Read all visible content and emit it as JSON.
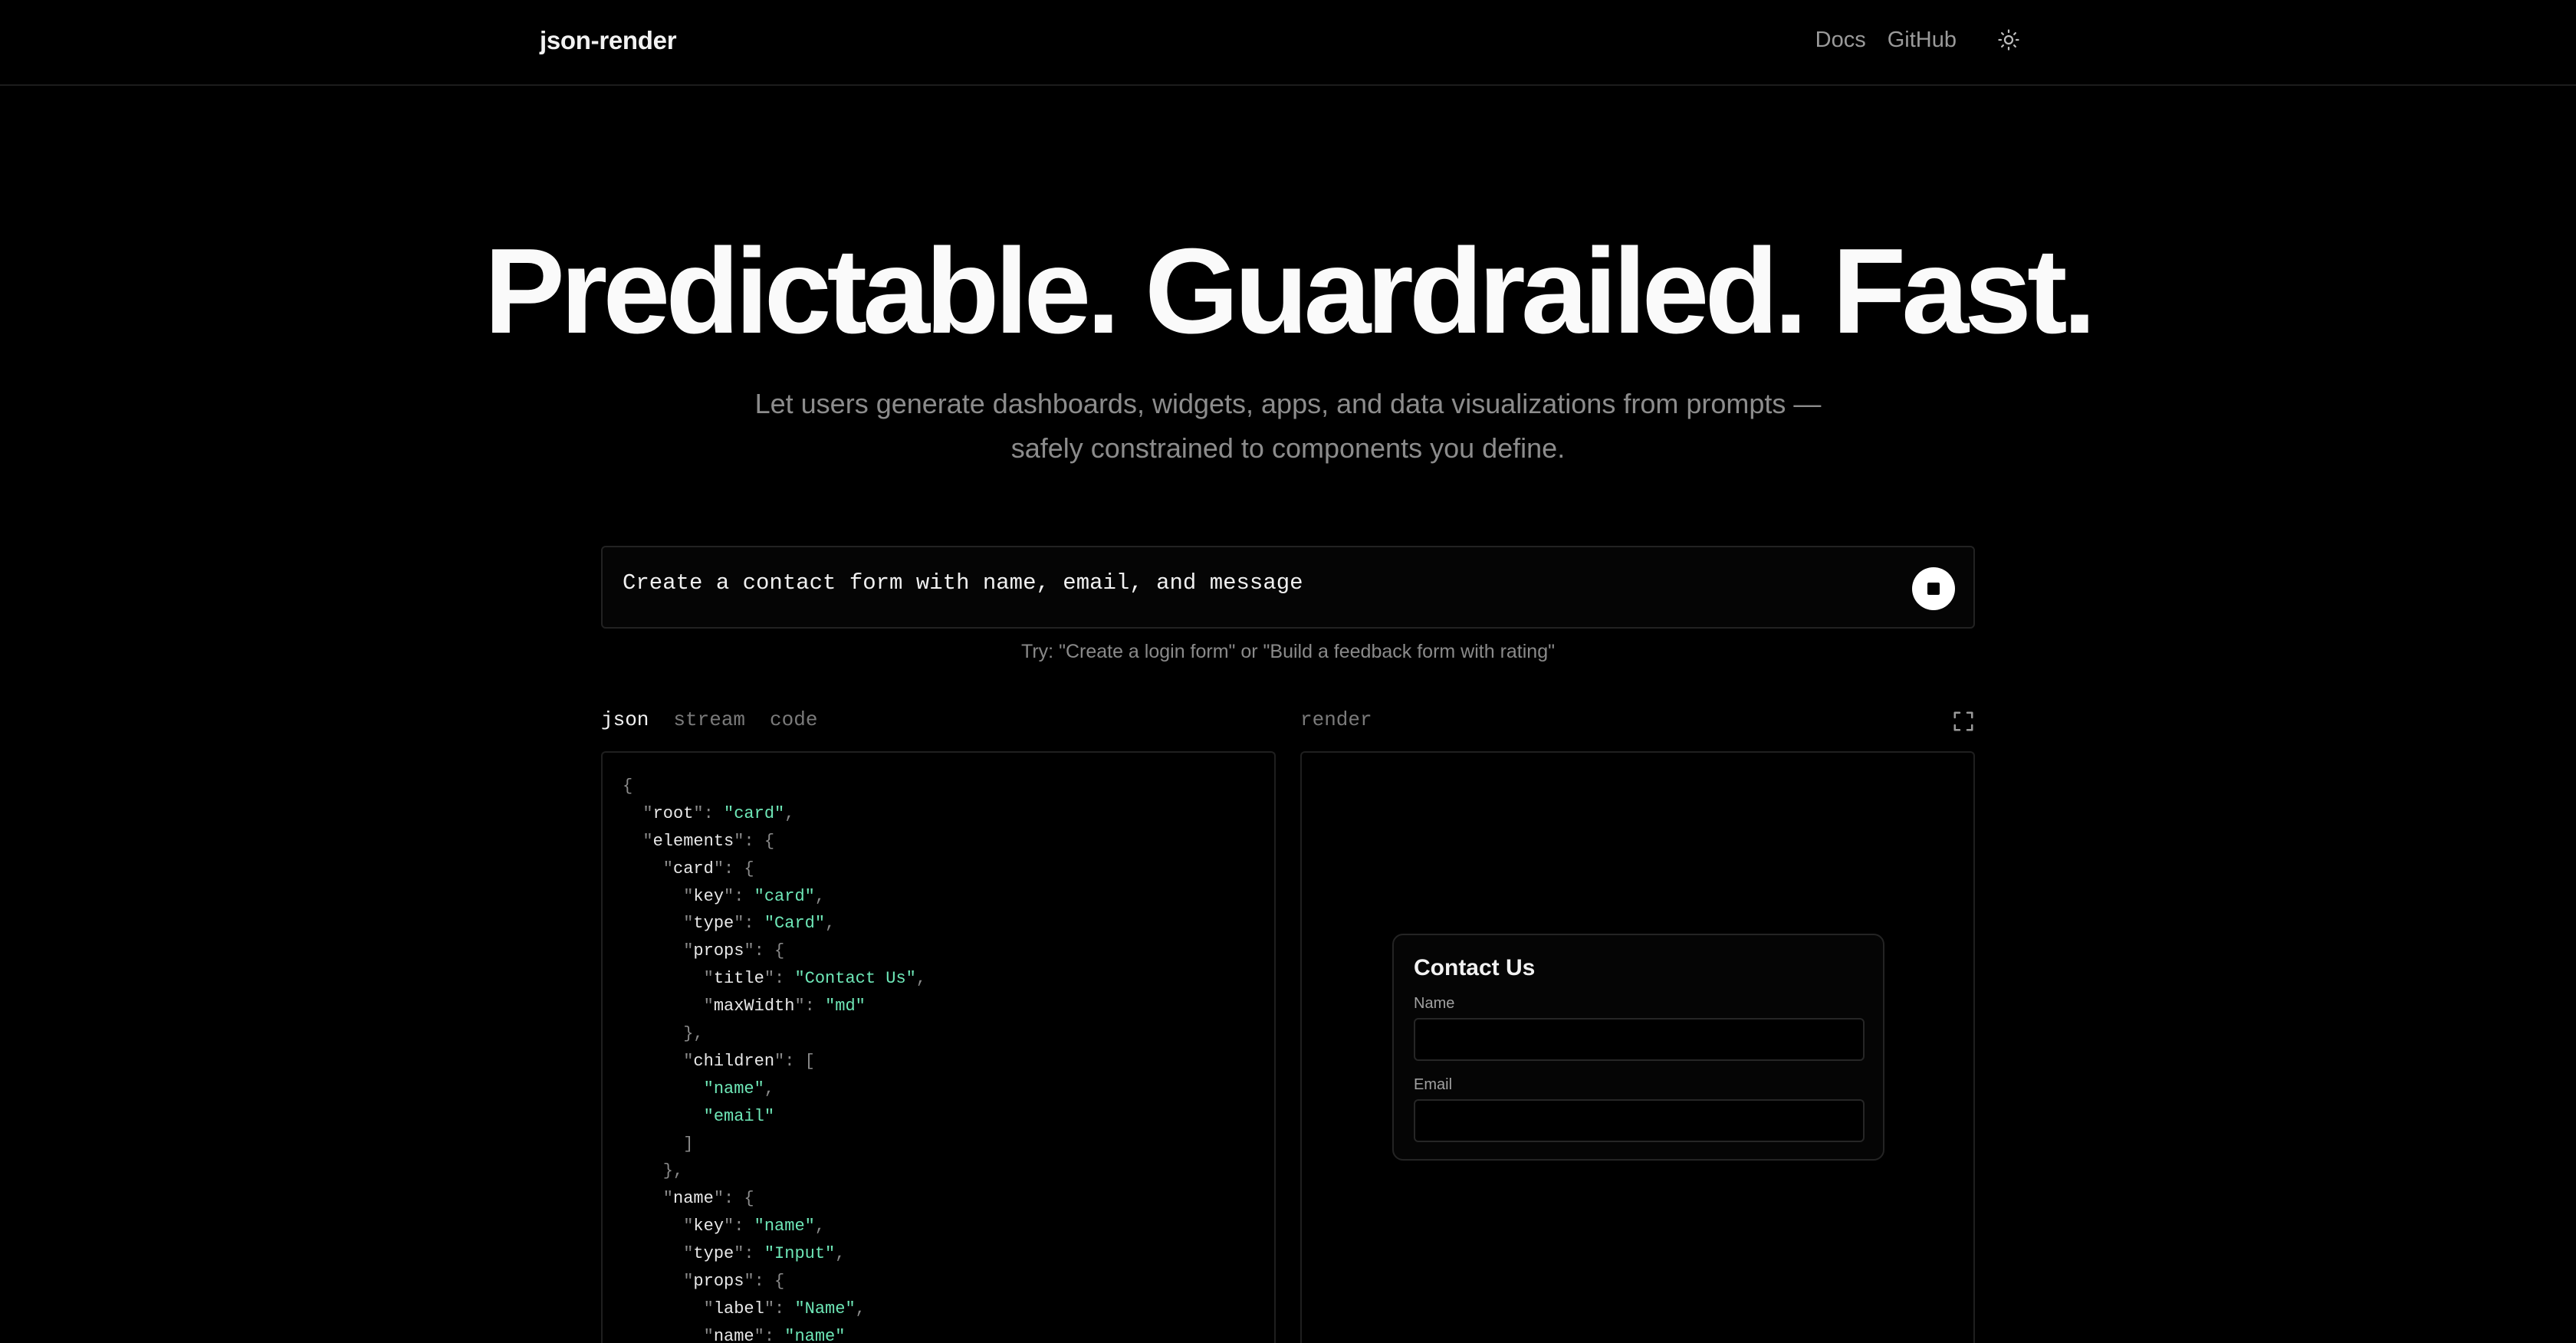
{
  "header": {
    "brand": "json-render",
    "nav": [
      {
        "label": "Docs"
      },
      {
        "label": "GitHub"
      }
    ],
    "theme_icon": "sun-icon"
  },
  "hero": {
    "title": "Predictable. Guardrailed. Fast.",
    "subtitle": "Let users generate dashboards, widgets, apps, and data visualizations from prompts — safely constrained to components you define."
  },
  "prompt": {
    "value": "Create a contact form with name, email, and message",
    "hint": "Try: \"Create a login form\" or \"Build a feedback form with rating\"",
    "stop_icon": "stop-icon"
  },
  "tabs": [
    {
      "label": "json",
      "active": true
    },
    {
      "label": "stream",
      "active": false
    },
    {
      "label": "code",
      "active": false
    }
  ],
  "render": {
    "label": "render",
    "expand_icon": "expand-icon",
    "card": {
      "title": "Contact Us",
      "fields": [
        {
          "label": "Name",
          "value": ""
        },
        {
          "label": "Email",
          "value": ""
        }
      ]
    }
  },
  "json_code": [
    [
      [
        "p",
        "{"
      ]
    ],
    [
      [
        "p",
        "  \""
      ],
      [
        "k",
        "root"
      ],
      [
        "p",
        "\": "
      ],
      [
        "s",
        "\"card\""
      ],
      [
        "p",
        ","
      ]
    ],
    [
      [
        "p",
        "  \""
      ],
      [
        "k",
        "elements"
      ],
      [
        "p",
        "\": {"
      ]
    ],
    [
      [
        "p",
        "    \""
      ],
      [
        "k",
        "card"
      ],
      [
        "p",
        "\": {"
      ]
    ],
    [
      [
        "p",
        "      \""
      ],
      [
        "k",
        "key"
      ],
      [
        "p",
        "\": "
      ],
      [
        "s",
        "\"card\""
      ],
      [
        "p",
        ","
      ]
    ],
    [
      [
        "p",
        "      \""
      ],
      [
        "k",
        "type"
      ],
      [
        "p",
        "\": "
      ],
      [
        "s",
        "\"Card\""
      ],
      [
        "p",
        ","
      ]
    ],
    [
      [
        "p",
        "      \""
      ],
      [
        "k",
        "props"
      ],
      [
        "p",
        "\": {"
      ]
    ],
    [
      [
        "p",
        "        \""
      ],
      [
        "k",
        "title"
      ],
      [
        "p",
        "\": "
      ],
      [
        "s",
        "\"Contact Us\""
      ],
      [
        "p",
        ","
      ]
    ],
    [
      [
        "p",
        "        \""
      ],
      [
        "k",
        "maxWidth"
      ],
      [
        "p",
        "\": "
      ],
      [
        "s",
        "\"md\""
      ]
    ],
    [
      [
        "p",
        "      },"
      ]
    ],
    [
      [
        "p",
        "      \""
      ],
      [
        "k",
        "children"
      ],
      [
        "p",
        "\": ["
      ]
    ],
    [
      [
        "p",
        "        "
      ],
      [
        "s",
        "\"name\""
      ],
      [
        "p",
        ","
      ]
    ],
    [
      [
        "p",
        "        "
      ],
      [
        "s",
        "\"email\""
      ]
    ],
    [
      [
        "p",
        "      ]"
      ]
    ],
    [
      [
        "p",
        "    },"
      ]
    ],
    [
      [
        "p",
        "    \""
      ],
      [
        "k",
        "name"
      ],
      [
        "p",
        "\": {"
      ]
    ],
    [
      [
        "p",
        "      \""
      ],
      [
        "k",
        "key"
      ],
      [
        "p",
        "\": "
      ],
      [
        "s",
        "\"name\""
      ],
      [
        "p",
        ","
      ]
    ],
    [
      [
        "p",
        "      \""
      ],
      [
        "k",
        "type"
      ],
      [
        "p",
        "\": "
      ],
      [
        "s",
        "\"Input\""
      ],
      [
        "p",
        ","
      ]
    ],
    [
      [
        "p",
        "      \""
      ],
      [
        "k",
        "props"
      ],
      [
        "p",
        "\": {"
      ]
    ],
    [
      [
        "p",
        "        \""
      ],
      [
        "k",
        "label"
      ],
      [
        "p",
        "\": "
      ],
      [
        "s",
        "\"Name\""
      ],
      [
        "p",
        ","
      ]
    ],
    [
      [
        "p",
        "        \""
      ],
      [
        "k",
        "name"
      ],
      [
        "p",
        "\": "
      ],
      [
        "s",
        "\"name\""
      ]
    ]
  ]
}
